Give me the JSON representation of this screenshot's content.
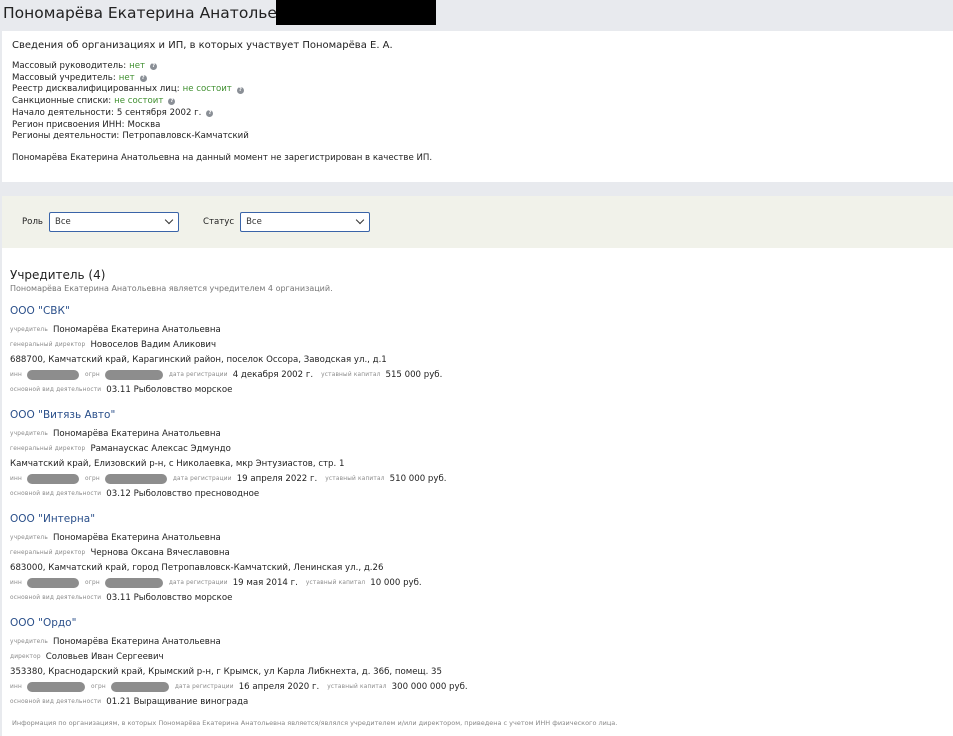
{
  "page": {
    "title": "Пономарёва Екатерина Анатольевна ("
  },
  "info": {
    "heading": "Сведения об организациях и ИП, в которых участвует Пономарёва Е. А.",
    "rows": [
      {
        "label": "Массовый руководитель:",
        "value": "нет",
        "green": true,
        "help": true
      },
      {
        "label": "Массовый учредитель:",
        "value": "нет",
        "green": true,
        "help": true
      },
      {
        "label": "Реестр дисквалифицированных лиц:",
        "value": "не состоит",
        "green": true,
        "help": true
      },
      {
        "label": "Санкционные списки:",
        "value": "не состоит",
        "green": true,
        "help": true
      },
      {
        "label": "Начало деятельности:",
        "value": "5 сентября 2002 г.",
        "green": false,
        "help": true
      },
      {
        "label": "Регион присвоения ИНН:",
        "value": "Москва",
        "green": false,
        "help": false
      },
      {
        "label": "Регионы деятельности:",
        "value": "Петропавловск-Камчатский",
        "green": false,
        "help": false
      }
    ],
    "ip_note": "Пономарёва Екатерина Анатольевна на данный момент не зарегистрирован в качестве ИП."
  },
  "filters": {
    "role_label": "Роль",
    "role_value": "Все",
    "status_label": "Статус",
    "status_value": "Все"
  },
  "section": {
    "title": "Учредитель (4)",
    "subtitle": "Пономарёва Екатерина Анатольевна является учредителем 4 организаций."
  },
  "labels": {
    "founder": "учредитель",
    "general_director": "генеральный директор",
    "director": "директор",
    "inn": "инн",
    "ogrn": "огрн",
    "reg_date": "дата регистрации",
    "capital": "уставный капитал",
    "main_activity": "основной вид деятельности"
  },
  "orgs": [
    {
      "name": "ООО \"СВК\"",
      "founder": "Пономарёва Екатерина Анатольевна",
      "director_role": "генеральный директор",
      "director": "Новоселов Вадим Аликович",
      "address": "688700, Камчатский край, Карагинский район, поселок Оссора, Заводская ул., д.1",
      "reg_date": "4 декабря 2002 г.",
      "capital": "515 000 руб.",
      "activity": "03.11 Рыболовство морское"
    },
    {
      "name": "ООО \"Витязь Авто\"",
      "founder": "Пономарёва Екатерина Анатольевна",
      "director_role": "генеральный директор",
      "director": "Раманаускас Алексас Эдмундо",
      "address": "Камчатский край, Елизовский р-н, с Николаевка, мкр Энтузиастов, стр. 1",
      "reg_date": "19 апреля 2022 г.",
      "capital": "510 000 руб.",
      "activity": "03.12 Рыболовство пресноводное"
    },
    {
      "name": "ООО \"Интерна\"",
      "founder": "Пономарёва Екатерина Анатольевна",
      "director_role": "генеральный директор",
      "director": "Чернова Оксана Вячеславовна",
      "address": "683000, Камчатский край, город Петропавловск-Камчатский, Ленинская ул., д.26",
      "reg_date": "19 мая 2014 г.",
      "capital": "10 000 руб.",
      "activity": "03.11 Рыболовство морское"
    },
    {
      "name": "ООО \"Ордо\"",
      "founder": "Пономарёва Екатерина Анатольевна",
      "director_role": "директор",
      "director": "Соловьев Иван Сергеевич",
      "address": "353380, Краснодарский край, Крымский р-н, г Крымск, ул Карла Либкнехта, д. 36б, помещ. 35",
      "reg_date": "16 апреля 2020 г.",
      "capital": "300 000 000 руб.",
      "activity": "01.21 Выращивание винограда"
    }
  ],
  "footer": "Информация по организациям, в которых Пономарёва Екатерина Анатольевна является/являлся учредителем и/или директором, приведена с учетом ИНН физического лица."
}
